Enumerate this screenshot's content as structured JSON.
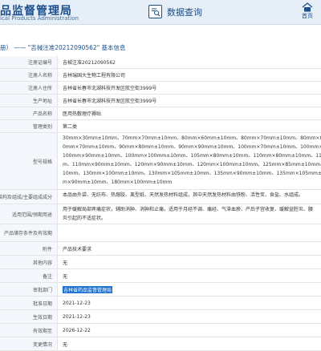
{
  "header": {
    "title": "品监督管理局",
    "subtitle": "ical Products Administration",
    "query_label": "数据查询",
    "home_label": "首页"
  },
  "breadcrumb": "册） —— \"吉械注准20212090562\" 基本信息",
  "rows": [
    {
      "label": "注册证编号",
      "value": "吉械注准20212090562"
    },
    {
      "label": "注册人名称",
      "value": "吉林瑞国大生物工程有限公司"
    },
    {
      "label": "注册人住所",
      "value": "吉林省长春市北湖科技开发区航空街3999号"
    },
    {
      "label": "生产地址",
      "value": "吉林省长春市北湖科技开发区航空街3999号"
    },
    {
      "label": "产品名称",
      "value": "医用热敷理疗褥贴"
    },
    {
      "label": "管理类别",
      "value": "第二类"
    },
    {
      "label": "型号规格",
      "lines": [
        "30mm×30mm±10mm、70mm×70mm±10mm、80mm×60mm±10mm、80mm×70mm±10mm、80mm×80",
        "0mm×70mm±10mm、90mm×80mm±10mm、90mm×90mm±10mm、100mm×70mm±10mm、100mm×80",
        "100mm×90mm±10mm、100mm×100mm±10mm、105mm×80mm±10mm、110mm×80mm±10mm、110m",
        "m、110mm×90mm±10mm、120mm×90mm±10mm、120mm×100mm±10mm、125mm×85mm±10mm、",
        "10mm、130mm×100mm±10mm、130mm×105mm±10mm、135mm×90mm±10mm、135mm×105mm±",
        "m×90mm±10mm、180mm×100mm±10mm"
      ]
    },
    {
      "label": "结构及组成/主要组成成分",
      "lines": [
        "本品由外袋、无纺布、热熔胶、离型纸、天然发热材料组成，其中天然发热材料由铁粉、活性炭、食盐、水组成。"
      ]
    },
    {
      "label": "适用范围/预期用途",
      "lines": [
        "用于缓解局部疼痛症状，辅助消肿、消肿和止痛，适用于月经不调、痛经、气滞血瘀、产后子宫收复、缓解盆腔炎、腰",
        "炎引起的不适症状。"
      ]
    },
    {
      "label": "产品储存条件及有效期",
      "value": ""
    },
    {
      "label": "附件",
      "value": "产品技术要求"
    },
    {
      "label": "其他内容",
      "value": "无"
    },
    {
      "label": "备注",
      "value": "无"
    },
    {
      "label": "审批部门",
      "value": "吉林省药品监督管理局",
      "highlight": true
    },
    {
      "label": "批准日期",
      "value": "2021-12-23"
    },
    {
      "label": "生效日期",
      "value": "2021-12-23"
    },
    {
      "label": "有效期至",
      "value": "2026-12-22"
    },
    {
      "label": "变更情况",
      "value": "无"
    }
  ]
}
